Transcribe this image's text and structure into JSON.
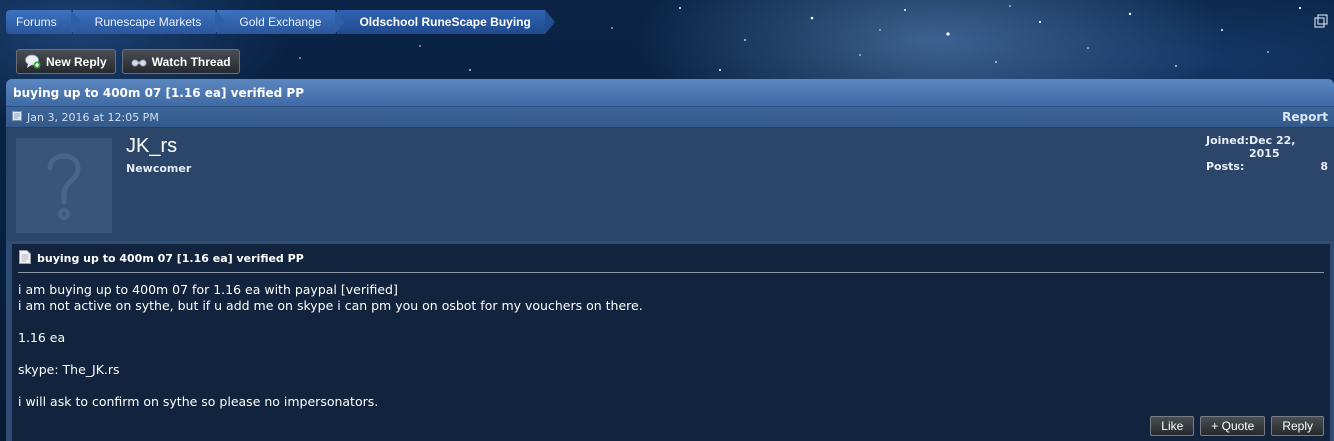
{
  "breadcrumb": {
    "items": [
      {
        "label": "Forums"
      },
      {
        "label": "Runescape Markets"
      },
      {
        "label": "Gold Exchange"
      },
      {
        "label": "Oldschool RuneScape Buying"
      }
    ]
  },
  "toolbar": {
    "new_reply_label": "New Reply",
    "watch_thread_label": "Watch Thread"
  },
  "thread": {
    "title": "buying up to 400m 07 [1.16 ea] verified PP"
  },
  "post": {
    "date": "Jan 3, 2016 at 12:05 PM",
    "report_label": "Report",
    "author": {
      "username": "JK_rs",
      "user_title": "Newcomer",
      "joined_label": "Joined:",
      "joined_value": "Dec 22, 2015",
      "posts_label": "Posts:",
      "posts_value": "8"
    },
    "title": "buying up to 400m 07 [1.16 ea] verified PP",
    "message": "i am buying up to 400m 07 for 1.16 ea with paypal [verified]\ni am not active on sythe, but if u add me on skype i can pm you on osbot for my vouchers on there.\n\n1.16 ea\n\nskype: The_JK.rs\n\ni will ask to confirm on sythe so please no impersonators.",
    "actions": {
      "like_label": "Like",
      "quote_label": "+ Quote",
      "reply_label": "Reply"
    }
  },
  "icons": {
    "new_reply": "speech-bubble-plus-icon",
    "watch_thread": "binoculars-icon",
    "date": "document-icon",
    "post_title": "page-icon",
    "popout": "popout-icon"
  },
  "colors": {
    "breadcrumb_bg": "#2f5fa6",
    "title_bar": "#4a76b2",
    "post_body_bg": "#12233d"
  }
}
